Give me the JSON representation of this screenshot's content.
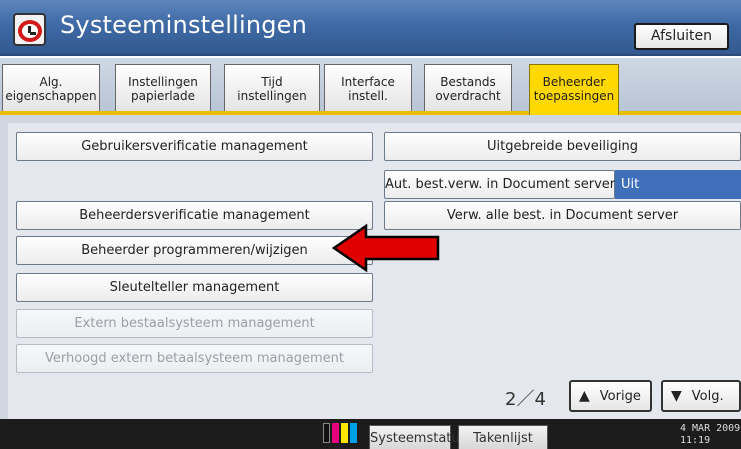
{
  "window": {
    "title": "Systeeminstellingen",
    "exit_label": "Afsluiten"
  },
  "tabs": [
    {
      "line1": "Alg.",
      "line2": "eigenschappen",
      "active": false
    },
    {
      "line1": "Instellingen",
      "line2": "papierlade",
      "active": false
    },
    {
      "line1": "Tijd",
      "line2": "instellingen",
      "active": false
    },
    {
      "line1": "Interface",
      "line2": "instell.",
      "active": false
    },
    {
      "line1": "Bestands",
      "line2": "overdracht",
      "active": false
    },
    {
      "line1": "Beheerder",
      "line2": "toepassingen",
      "active": true
    }
  ],
  "left_buttons": [
    {
      "label": "Gebruikersverificatie management",
      "enabled": true
    },
    {
      "label": "Beheerdersverificatie management",
      "enabled": true
    },
    {
      "label": "Beheerder programmeren/wijzigen",
      "enabled": true
    },
    {
      "label": "Sleutelteller management",
      "enabled": true
    },
    {
      "label": "Extern bestaalsysteem management",
      "enabled": false
    },
    {
      "label": "Verhoogd extern betaalsysteem management",
      "enabled": false
    }
  ],
  "right_buttons": {
    "extended_security": "Uitgebreide beveiliging",
    "auto_delete_label": "Aut. best.verw. in Document server",
    "auto_delete_value": "Uit",
    "delete_all": "Verw. alle best. in Document server"
  },
  "pager": {
    "text": "2／4",
    "prev_label": "Vorige",
    "next_label": "Volg."
  },
  "bottom": {
    "system_status": "Systeemstatus",
    "job_list": "Takenlijst",
    "date": "4 MAR  2009",
    "time": "11:19"
  },
  "colors": {
    "title_bar": "#3f6aa6",
    "active_tab": "#ffd800",
    "highlight_arrow": "#e00000",
    "value_box": "#3e6fb8"
  },
  "icons": {
    "app": "alarm-clock-icon",
    "annotation": "red-arrow-icon",
    "toner": "toner-level-icon"
  }
}
